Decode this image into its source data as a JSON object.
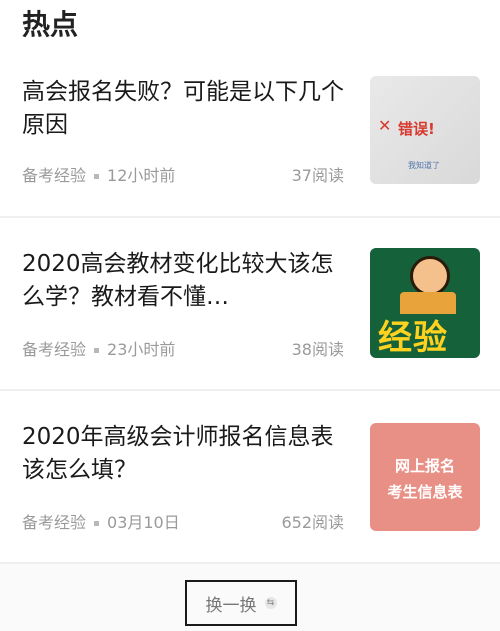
{
  "header": {
    "title": "热点"
  },
  "articles": [
    {
      "title": "高会报名失败？可能是以下几个原因",
      "source": "备考经验",
      "time": "12小时前",
      "reads": "37阅读",
      "thumb": {
        "icon": "error-screenshot",
        "text": "错误!",
        "mark": "✕",
        "small": "我知道了"
      }
    },
    {
      "title": "2020高会教材变化比较大该怎么学？教材看不懂…",
      "source": "备考经验",
      "time": "23小时前",
      "reads": "38阅读",
      "thumb": {
        "icon": "experience-badge",
        "text": "经验"
      }
    },
    {
      "title": "2020年高级会计师报名信息表该怎么填？",
      "source": "备考经验",
      "time": "03月10日",
      "reads": "652阅读",
      "thumb": {
        "icon": "text-banner",
        "line1": "网上报名",
        "line2": "考生信息表"
      }
    }
  ],
  "footer": {
    "refresh_label": "换一换",
    "refresh_icon": "refresh-icon"
  },
  "colors": {
    "accent_red": "#d63a2f",
    "meta_gray": "#9a9a9a",
    "thumb_pink": "#e99086",
    "thumb_green": "#14613a"
  }
}
